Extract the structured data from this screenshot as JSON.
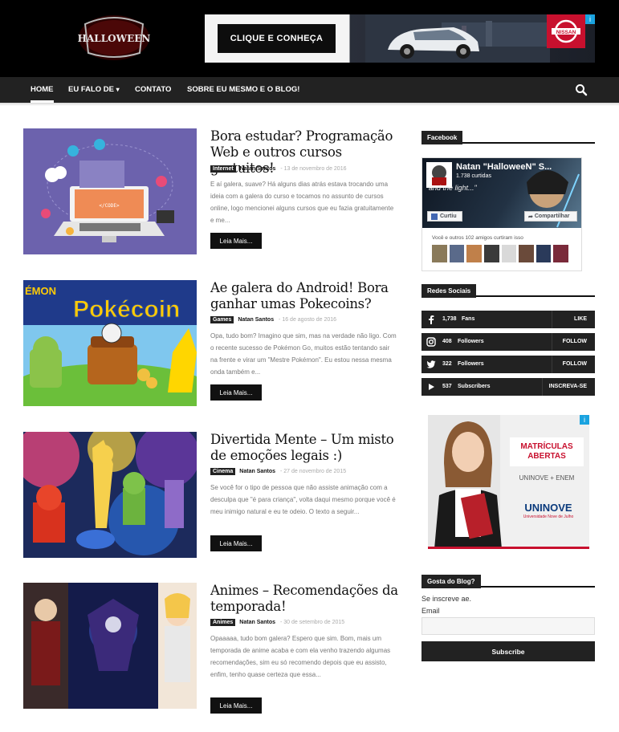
{
  "header": {
    "logo_text": "HALLOWEEN",
    "ad": {
      "button_label": "CLIQUE E CONHEÇA",
      "brand": "NISSAN",
      "close_label": "i"
    }
  },
  "nav": {
    "items": [
      {
        "label": "HOME",
        "active": true
      },
      {
        "label": "EU FALO DE",
        "dropdown": true
      },
      {
        "label": "CONTATO"
      },
      {
        "label": "SOBRE EU MESMO E O BLOG!"
      }
    ],
    "dropdown_glyph": "⌄"
  },
  "posts": [
    {
      "title": "Bora estudar? Programação Web e outros cursos gratuitos!",
      "category": "Internet",
      "author": "Natan Santos",
      "date": "13 de novembro de 2016",
      "excerpt": "E aí galera, suave? Há alguns dias atrás estava trocando uma ideia com a galera do curso e tocamos no assunto de cursos online, logo mencionei alguns cursos que eu fazia gratuitamente e me...",
      "read_more": "Leia Mais...",
      "thumb_label": "</CODE>"
    },
    {
      "title": "Ae galera do Android! Bora ganhar umas Pokecoins?",
      "category": "Games",
      "author": "Natan Santos",
      "date": "16 de agosto de 2016",
      "excerpt": "Opa, tudo bom? Imagino que sim, mas na verdade não ligo. Com o recente sucesso de Pokémon Go, muitos estão tentando sair na frente e virar um \"Mestre Pokémon\". Eu estou nessa mesma onda também e...",
      "read_more": "Leia Mais...",
      "thumb_label": "Pokécoin",
      "thumb_label_left": "ÉMON"
    },
    {
      "title": "Divertida Mente – Um misto de emoções legais :)",
      "category": "Cinema",
      "author": "Natan Santos",
      "date": "27 de novembro de 2015",
      "excerpt": "Se você for o tipo de pessoa que não assiste animação com a desculpa que \"é para criança\", volta daqui mesmo porque você é meu inimigo natural e eu te odeio. O texto a seguir...",
      "read_more": "Leia Mais..."
    },
    {
      "title": "Animes – Recomendações da temporada!",
      "category": "Animes",
      "author": "Natan Santos",
      "date": "30 de setembro de 2015",
      "excerpt": "Opaaaaa, tudo bom galera? Espero que sim. Bom, mais um temporada de anime acaba e com ela venho trazendo algumas recomendações, sim eu só recomendo depois que eu assisto, enfim, tenho quase certeza que essa...",
      "read_more": "Leia Mais..."
    }
  ],
  "sidebar": {
    "facebook": {
      "title": "Facebook",
      "page_name": "Natan \"HalloweeN\" S...",
      "likes": "1.738 curtidas",
      "tagline": "and the light...\"",
      "like_button": "Curtiu",
      "share_button": "Compartilhar",
      "friends_text": "Você e outros 102 amigos curtiram isso"
    },
    "social": {
      "title": "Redes Sociais",
      "items": [
        {
          "icon": "facebook-icon",
          "count": "1,738",
          "label": "Fans",
          "action": "LIKE"
        },
        {
          "icon": "instagram-icon",
          "count": "408",
          "label": "Followers",
          "action": "FOLLOW"
        },
        {
          "icon": "twitter-icon",
          "count": "322",
          "label": "Followers",
          "action": "FOLLOW"
        },
        {
          "icon": "youtube-icon",
          "count": "537",
          "label": "Subscribers",
          "action": "INSCREVA-SE"
        }
      ]
    },
    "ad": {
      "line1": "MATRÍCULAS",
      "line2": "ABERTAS",
      "line3": "UNINOVE + ENEM",
      "brand": "UNINOVE",
      "brand_sub": "Universidade Nove de Julho",
      "close_label": "i"
    },
    "subscribe": {
      "title": "Gosta do Blog?",
      "text": "Se inscreve ae.",
      "email_label": "Email",
      "email_placeholder": "",
      "button": "Subscribe"
    }
  },
  "colors": {
    "dark": "#222222",
    "black": "#000000",
    "nissan_red": "#c8102e",
    "uninove_red": "#c8102e",
    "uninove_blue": "#0a3a7c"
  }
}
